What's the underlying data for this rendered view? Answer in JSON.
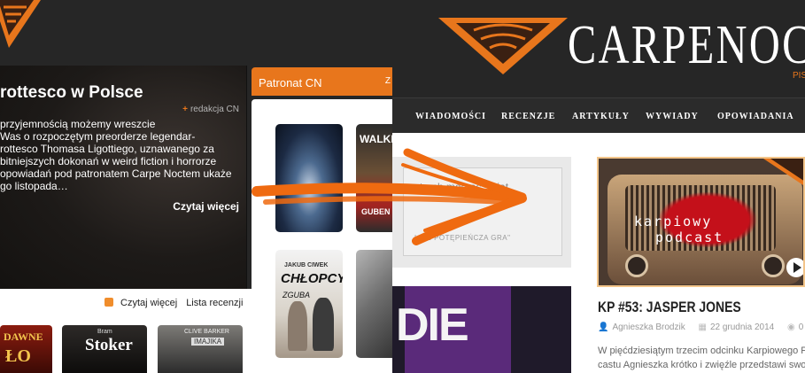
{
  "old_site": {
    "feature": {
      "title": "rottesco w Polsce",
      "author": "redakcja CN",
      "body_lines": [
        "przyjemnością możemy wreszcie",
        "Was o rozpoczętym preorderze legendar-",
        "rottesco Thomasa Ligottiego, uznawanego za",
        "bitniejszych dokonań w weird fiction i horrorze",
        "opowiadań pod patronatem Carpe Noctem ukaże",
        "go listopada…"
      ],
      "read_more": "Czytaj więcej"
    },
    "patronat": {
      "header": "Patronat CN",
      "header_suffix": "Z"
    },
    "books": [
      {
        "title": "WALKIN",
        "subtitle": "GUBEN"
      },
      {
        "author": "JAKUB CIWEK",
        "title": "CHŁOPCY",
        "subtitle": "ZGUBA"
      }
    ],
    "links": {
      "rss": "rss-icon",
      "read_more": "Czytaj więcej",
      "review_list": "Lista recenzji"
    },
    "covers": [
      {
        "line1": "DAWNE",
        "line2": "ŁO"
      },
      {
        "author": "Bram",
        "title": "Stoker"
      },
      {
        "author": "CLIVE BARKER",
        "title": "IMAJIKA"
      }
    ]
  },
  "new_site": {
    "brand": "CARPENOC",
    "brand_sub": "PIS",
    "nav": [
      "WIADOMOŚCI",
      "RECENZJE",
      "ARTYKUŁY",
      "WYWIADY",
      "OPOWIADANIA"
    ],
    "quote": {
      "text": "strach mog          ać świat,",
      "source": "LIVE             POTĘPIEŃCZA GRA\""
    },
    "dark_image_text": "DIE",
    "podcast": {
      "line1": "karpiowy",
      "line2": "podcast"
    },
    "post": {
      "title": "KP #53: JASPER JONES",
      "author": "Agnieszka Brodzik",
      "date": "22 grudnia 2014",
      "comments": "0",
      "excerpt_lines": [
        "W pięćdziesiątym trzecim odcinku Karpiowego Po",
        "castu Agnieszka krótko i zwięźle przedstawi swoja"
      ]
    }
  },
  "colors": {
    "accent": "#e8761c",
    "dark": "#262626"
  }
}
